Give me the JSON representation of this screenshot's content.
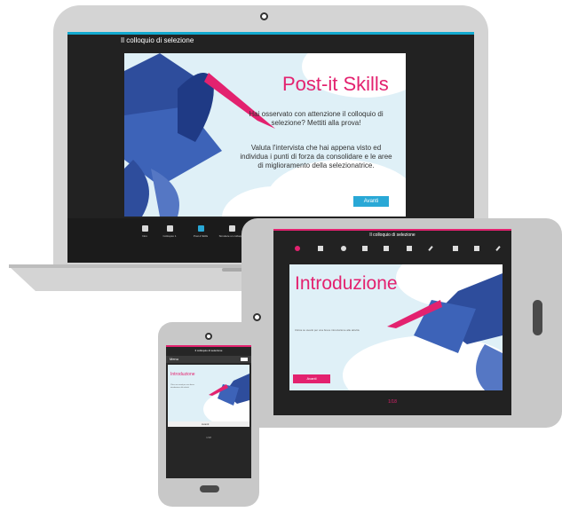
{
  "laptop": {
    "app_title": "Il colloquio di selezione",
    "slide": {
      "title": "Post-it Skills",
      "paragraph1": "Hai osservato con attenzione il colloquio di selezione? Mettiti alla prova!",
      "paragraph2": "Valuta l'intervista che hai appena visto ed individua i punti di forza da consolidare e le aree di miglioramento della selezionatrice.",
      "button": "Avanti"
    },
    "toolbar": [
      {
        "label": "Intro",
        "icon": "map-pin-icon"
      },
      {
        "label": "Colloquio 1",
        "icon": "video-icon"
      },
      {
        "label": "Post-it Skills",
        "icon": "layers-icon"
      },
      {
        "label": "Simulare un colloquio",
        "icon": "screen-icon"
      }
    ]
  },
  "tablet": {
    "app_title": "Il colloquio di selezione",
    "slide": {
      "title": "Introduzione",
      "hint": "Clicca su avanti per una breve introduzione alle attività",
      "button": "Avanti"
    },
    "pager": "1/18"
  },
  "phone": {
    "app_title": "Il colloquio di selezione",
    "menu_label": "Menu",
    "slide": {
      "title": "Introduzione",
      "hint": "Clicca su avanti per una breve introduzione alle attività",
      "button": "Avanti"
    },
    "pager": "1/18"
  },
  "colors": {
    "accent_magenta": "#e3226f",
    "accent_blue": "#12a9cf",
    "button_blue": "#29a8d6",
    "bird_blue": "#2e4d9c",
    "sky": "#dff0f7"
  }
}
